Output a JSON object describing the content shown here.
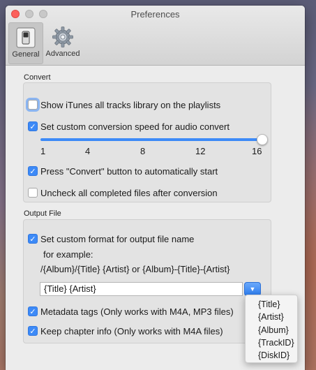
{
  "window": {
    "title": "Preferences"
  },
  "toolbar": {
    "tabs": [
      {
        "label": "General",
        "icon": "switch-icon",
        "selected": true
      },
      {
        "label": "Advanced",
        "icon": "gear-icon",
        "selected": false
      }
    ]
  },
  "convert": {
    "title": "Convert",
    "show_itunes": {
      "label": "Show iTunes all tracks library on the playlists",
      "checked": false
    },
    "custom_speed": {
      "label": "Set custom conversion speed for audio convert",
      "checked": true
    },
    "speed_slider": {
      "ticks": [
        "1",
        "4",
        "8",
        "12",
        "16"
      ],
      "value": 16
    },
    "auto_start": {
      "label": "Press \"Convert\" button to automatically start",
      "checked": true
    },
    "uncheck_completed": {
      "label": "Uncheck all completed files after conversion",
      "checked": false
    }
  },
  "output": {
    "title": "Output File",
    "custom_format": {
      "label": "Set custom format for output file name",
      "checked": true
    },
    "example_label": "for example:",
    "example_text": "/{Album}/{Title} {Artist} or {Album}-{Title}-{Artist}",
    "format_value": "{Title} {Artist}",
    "metadata_tags": {
      "label": "Metadata tags (Only works with M4A, MP3 files)",
      "checked": true
    },
    "chapter_info": {
      "label": "Keep chapter info (Only works with M4A files)",
      "checked": true
    }
  },
  "format_menu": {
    "items": [
      "{Title}",
      "{Artist}",
      "{Album}",
      "{TrackID}",
      "{DiskID}"
    ]
  },
  "colors": {
    "accent": "#3d8af7",
    "close": "#fc605c"
  }
}
